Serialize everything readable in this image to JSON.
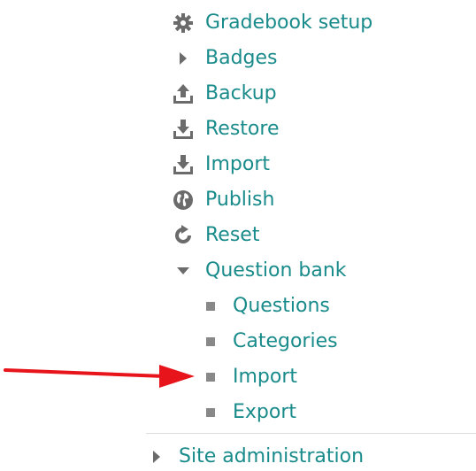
{
  "menu": {
    "gradebook_setup": "Gradebook setup",
    "badges": "Badges",
    "backup": "Backup",
    "restore": "Restore",
    "import": "Import",
    "publish": "Publish",
    "reset": "Reset",
    "question_bank": {
      "label": "Question bank",
      "items": [
        "Questions",
        "Categories",
        "Import",
        "Export"
      ]
    },
    "site_administration": "Site administration"
  },
  "colors": {
    "link": "#1a8b8b",
    "icon": "#6b6b6b",
    "arrow": "#e8141b"
  }
}
